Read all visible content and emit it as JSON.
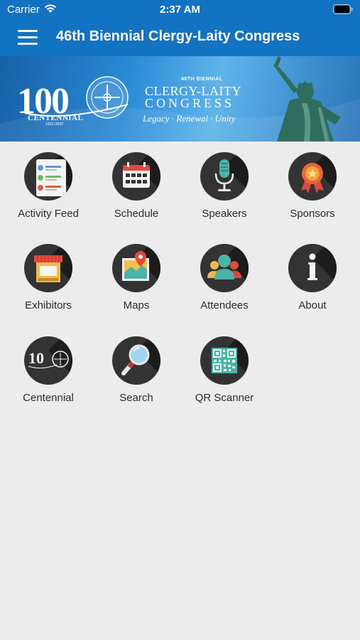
{
  "status_bar": {
    "carrier": "Carrier",
    "time": "2:37 AM"
  },
  "nav": {
    "title": "46th Biennial Clergy-Laity Congress",
    "menu_icon": "hamburger-menu-icon"
  },
  "banner": {
    "logo_year": "100",
    "logo_label": "CENTENNIAL",
    "logo_years": "1922–2022",
    "kicker": "46TH BIENNIAL",
    "title_line1": "CLERGY-LAITY",
    "title_line2": "CONGRESS",
    "motto": "Legacy · Renewal · Unity"
  },
  "menu_items": [
    {
      "label": "Activity Feed",
      "icon": "activity-feed-icon"
    },
    {
      "label": "Schedule",
      "icon": "calendar-icon"
    },
    {
      "label": "Speakers",
      "icon": "microphone-icon"
    },
    {
      "label": "Sponsors",
      "icon": "award-ribbon-icon"
    },
    {
      "label": "Exhibitors",
      "icon": "storefront-icon"
    },
    {
      "label": "Maps",
      "icon": "map-pin-icon"
    },
    {
      "label": "Attendees",
      "icon": "people-icon"
    },
    {
      "label": "About",
      "icon": "info-icon"
    },
    {
      "label": "Centennial",
      "icon": "centennial-logo-icon"
    },
    {
      "label": "Search",
      "icon": "magnifier-icon"
    },
    {
      "label": "QR Scanner",
      "icon": "qr-code-icon"
    }
  ],
  "colors": {
    "nav_blue": "#1273c2",
    "background": "#ececec",
    "icon_circle": "#333333"
  }
}
